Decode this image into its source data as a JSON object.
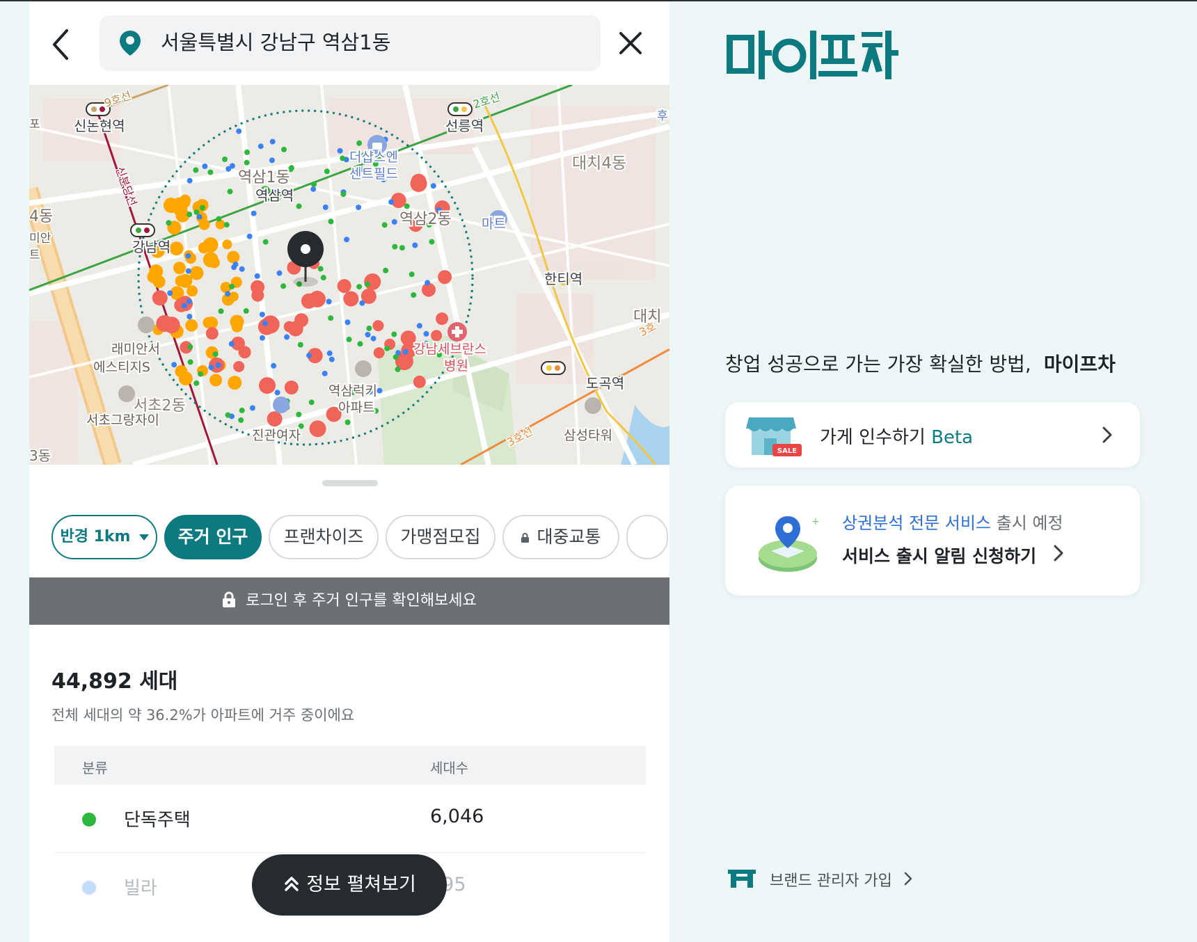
{
  "header": {
    "search_value": "서울특별시 강남구 역삼1동"
  },
  "map": {
    "labels": {
      "sinnonhyeon": "신논현역",
      "line9": "9호선",
      "line2_top": "2호선",
      "seolleung": "선릉역",
      "daechi4": "대치4동",
      "yeoksam1": "역삼1동",
      "yeoksam_st": "역삼역",
      "thesharp": "더샵스엔",
      "thesharp2": "센트필드",
      "yeoksam2": "역삼2동",
      "mart": "마트",
      "dong4": "4동",
      "gangnam_st": "강남역",
      "sinbundang": "신분당선",
      "hanti": "한티역",
      "daechi": "대치",
      "severance1": "강남세브란스",
      "severance2": "병원",
      "raemian1": "래미안서",
      "raemian2": "에스티지S",
      "seocho2": "서초2동",
      "seocho_grand": "서초그랑자이",
      "yeoksam_lucky1": "역삼럭키",
      "yeoksam_lucky2": "아파트",
      "dogok": "도곡역",
      "line3": "3호선",
      "line3b": "3호",
      "samsung_tower": "삼성타워",
      "jingwan": "진관여자",
      "edge_left1": "포",
      "edge_left2": "미안",
      "edge_left3": "트",
      "edge_left4": "3동",
      "edge_right": "후"
    },
    "legend_colors": {
      "house": "#2db83d",
      "villa": "#3b82f6",
      "apartment_small": "#ffa600",
      "apartment_large": "#f0645a"
    }
  },
  "filters": {
    "radius": "반경 1km",
    "chips": [
      "주거 인구",
      "프랜차이즈",
      "가맹점모집",
      "대중교통"
    ]
  },
  "login_notice": "로그인 후 주거 인구를 확인해보세요",
  "summary": {
    "households": "44,892 세대",
    "description": "전체 세대의 약 36.2%가 아파트에 거주 중이에요"
  },
  "table": {
    "headers": [
      "분류",
      "세대수"
    ],
    "rows": [
      {
        "name": "단독주택",
        "value": "6,046",
        "color": "#2db83d"
      },
      {
        "name": "빌라",
        "value": "095",
        "color": "#c4dcfb"
      }
    ]
  },
  "expand_button": "정보 펼쳐보기",
  "right": {
    "logo_text": "마이프차",
    "tagline": "창업 성공으로 가는 가장 확실한 방법,",
    "tagline_brand": "마이프차",
    "card1": {
      "label": "가게 인수하기",
      "beta": "Beta",
      "badge": "SALE"
    },
    "card2": {
      "highlight": "상권분석 전문 서비스",
      "rest": " 출시 예정",
      "cta": "서비스 출시 알림 신청하기"
    },
    "brand_join": "브랜드 관리자 가입"
  },
  "colors": {
    "brand_teal": "#0d7a80",
    "accent_blue": "#2e6fd6"
  }
}
